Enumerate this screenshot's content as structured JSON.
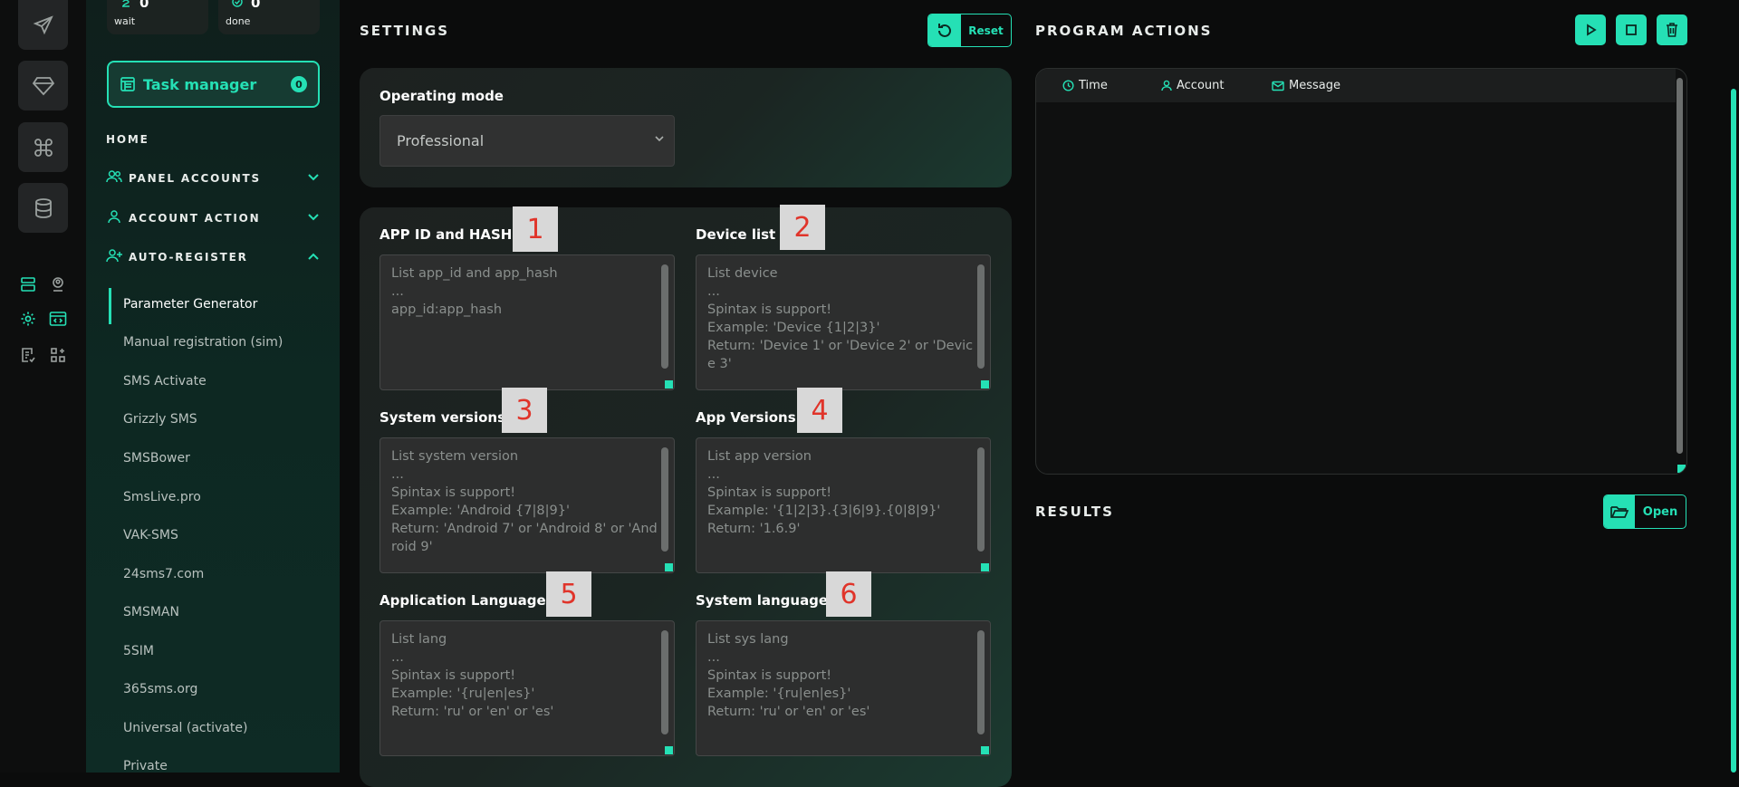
{
  "accent_color": "#25e0b5",
  "stats": [
    {
      "count": "0",
      "label": "wait",
      "icon": "hourglass-icon"
    },
    {
      "count": "0",
      "label": "done",
      "icon": "check-circle-icon"
    }
  ],
  "task_manager": {
    "label": "Task manager",
    "count": "0"
  },
  "nav": {
    "home": "HOME",
    "panel_accounts": "PANEL ACCOUNTS",
    "account_action": "ACCOUNT ACTION",
    "auto_register": "AUTO-REGISTER",
    "items": [
      "Parameter Generator",
      "Manual registration (sim)",
      "SMS Activate",
      "Grizzly SMS",
      "SMSBower",
      "SmsLive.pro",
      "VAK-SMS",
      "24sms7.com",
      "SMSMAN",
      "5SIM",
      "365sms.org",
      "Universal (activate)",
      "Private"
    ],
    "active_item": "Parameter Generator"
  },
  "settings": {
    "title": "SETTINGS",
    "reset_label": "Reset",
    "operating_mode_label": "Operating mode",
    "operating_mode_value": "Professional",
    "fields": [
      {
        "label": "APP ID and HASH",
        "badge": "1",
        "placeholder": "List app_id and app_hash\n...\napp_id:app_hash"
      },
      {
        "label": "Device list",
        "badge": "2",
        "placeholder": "List device\n...\nSpintax is support!\nExample: 'Device {1|2|3}'\nReturn: 'Device 1' or 'Device 2' or 'Device 3'"
      },
      {
        "label": "System versions",
        "badge": "3",
        "placeholder": "List system version\n...\nSpintax is support!\nExample: 'Android {7|8|9}'\nReturn: 'Android 7' or 'Android 8' or 'Android 9'"
      },
      {
        "label": "App Versions",
        "badge": "4",
        "placeholder": "List app version\n...\nSpintax is support!\nExample: '{1|2|3}.{3|6|9}.{0|8|9}'\nReturn: '1.6.9'"
      },
      {
        "label": "Application Language",
        "badge": "5",
        "placeholder": "List lang\n...\nSpintax is support!\nExample: '{ru|en|es}'\nReturn: 'ru' or 'en' or 'es'"
      },
      {
        "label": "System language",
        "badge": "6",
        "placeholder": "List sys lang\n...\nSpintax is support!\nExample: '{ru|en|es}'\nReturn: 'ru' or 'en' or 'es'"
      }
    ]
  },
  "program_actions": {
    "title": "PROGRAM ACTIONS",
    "columns": [
      "Time",
      "Account",
      "Message"
    ]
  },
  "results": {
    "title": "RESULTS",
    "open_label": "Open"
  }
}
